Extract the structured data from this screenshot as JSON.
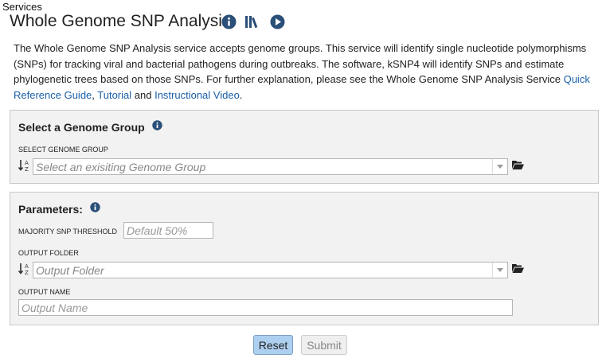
{
  "breadcrumb": "Services",
  "page_title": "Whole Genome SNP Analysis",
  "description": {
    "text": "The Whole Genome SNP Analysis service accepts genome groups. This service will identify single nucleotide polymorphisms (SNPs) for tracking viral and bacterial pathogens during outbreaks. The software, kSNP4 will identify SNPs and estimate phylogenetic trees based on those SNPs. For further explanation, please see the Whole Genome SNP Analysis Service ",
    "link_quick_reference": "Quick Reference Guide",
    "sep1": ", ",
    "link_tutorial": "Tutorial",
    "sep2": " and ",
    "link_video": "Instructional Video",
    "end": "."
  },
  "genome_group_panel": {
    "title": "Select a Genome Group",
    "field_label": "SELECT GENOME GROUP",
    "placeholder": "Select an exisiting Genome Group"
  },
  "parameters_panel": {
    "title": "Parameters:",
    "threshold_label": "MAJORITY SNP THRESHOLD",
    "threshold_placeholder": "Default 50%",
    "output_folder_label": "OUTPUT FOLDER",
    "output_folder_placeholder": "Output Folder",
    "output_name_label": "OUTPUT NAME",
    "output_name_placeholder": "Output Name"
  },
  "buttons": {
    "reset": "Reset",
    "submit": "Submit"
  },
  "icons": [
    "info-icon",
    "library-icon",
    "play-icon",
    "sort-az-icon",
    "folder-open-icon",
    "chevron-down-icon"
  ],
  "colors": {
    "link": "#1a5fa8",
    "reset_button": "#aed0f0",
    "panel_bg": "#f2f2f2"
  }
}
